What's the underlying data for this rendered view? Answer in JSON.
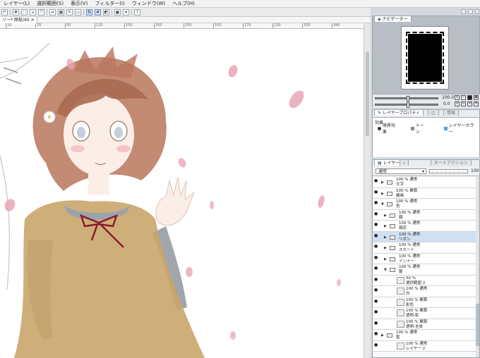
{
  "menu": [
    "レイヤー(L)",
    "選択範囲(S)",
    "表示(V)",
    "フィルター(I)",
    "ウィンドウ(W)",
    "ヘルプ(H)"
  ],
  "document_tab": "リー* 原紙/40",
  "ruler_ticks": [
    "10",
    "20",
    "50",
    "120",
    "100",
    "200",
    "250",
    "100",
    "170",
    "120",
    "330",
    "340"
  ],
  "navigator": {
    "tab": "ナビゲーター",
    "zoom_value": "100.0",
    "angle_value": "0.0"
  },
  "properties": {
    "tabs": [
      "レイヤープロパティ",
      "",
      "情報"
    ],
    "header": "効果",
    "effects": [
      {
        "label": "境界効果",
        "icon": "circle-icon"
      },
      {
        "label": "トーン",
        "icon": "tone-icon"
      },
      {
        "label": "レイヤーカラー",
        "icon": "color-icon"
      }
    ]
  },
  "layers": {
    "tabs": [
      "レイヤー",
      "",
      "オートアクション"
    ],
    "blend_mode": "通常",
    "opacity": "100",
    "rows": [
      {
        "line1": "100 % 通常",
        "line2": "文字",
        "kind": "folder",
        "selected": false
      },
      {
        "line1": "100 % 乗算",
        "line2": "線画",
        "kind": "folder",
        "selected": false
      },
      {
        "line1": "100 % 通常",
        "line2": "色",
        "kind": "folder-open",
        "selected": false
      },
      {
        "line1": "100 % 通常",
        "line2": "顔",
        "kind": "folder",
        "selected": false
      },
      {
        "line1": "100 % 通常",
        "line2": "頭花",
        "kind": "folder",
        "selected": false
      },
      {
        "line1": "100 % 通常",
        "line2": "リボン",
        "kind": "folder",
        "selected": true
      },
      {
        "line1": "100 % 通常",
        "line2": "スカート",
        "kind": "folder",
        "selected": false
      },
      {
        "line1": "100 % 通常",
        "line2": "インナー",
        "kind": "folder",
        "selected": false
      },
      {
        "line1": "100 % 通常",
        "line2": "服",
        "kind": "folder-open",
        "selected": false
      },
      {
        "line1": "50 %",
        "line2": "選択範囲 2",
        "kind": "thumb",
        "selected": false
      },
      {
        "line1": "100 % 通常",
        "line2": "白",
        "kind": "thumb",
        "selected": false
      },
      {
        "line1": "100 % 乗算",
        "line2": "影色",
        "kind": "thumb",
        "selected": false
      },
      {
        "line1": "100 % 乗算",
        "line2": "透明-影",
        "kind": "thumb",
        "selected": false
      },
      {
        "line1": "100 % 乗算",
        "line2": "透明-全体",
        "kind": "thumb",
        "selected": false
      },
      {
        "line1": "100 % 通常",
        "line2": "髪",
        "kind": "folder",
        "selected": false
      },
      {
        "line1": "100 % 通常",
        "line2": "レイヤー 2",
        "kind": "thumb",
        "selected": false
      }
    ]
  },
  "colors": {
    "accent": "#cfe0f2",
    "tone": "#8a8a8a",
    "layer_color": "#4aa0e0",
    "petal": "#e8a5b5",
    "hair": "#b9765c",
    "dress": "#c9a56a"
  }
}
